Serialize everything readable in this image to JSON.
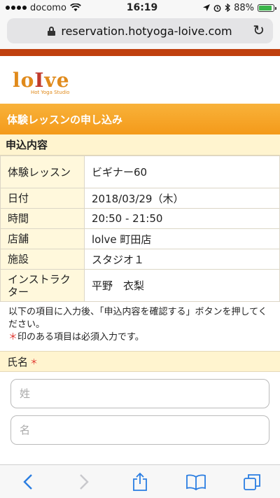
{
  "status": {
    "carrier": "docomo",
    "time": "16:19",
    "battery": "88%",
    "battery_level": 0.88
  },
  "browser": {
    "url": "reservation.hotyoga-loive.com"
  },
  "logo": {
    "text_a": "lo",
    "text_i": "I",
    "text_b": "ve",
    "sub": "Hot Yoga Studio"
  },
  "section": {
    "title": "体験レッスンの申し込み",
    "subtitle": "申込内容"
  },
  "details": [
    {
      "label": "体験レッスン",
      "value": "ビギナー60"
    },
    {
      "label": "日付",
      "value": "2018/03/29（木）"
    },
    {
      "label": "時間",
      "value": "20:50 - 21:50"
    },
    {
      "label": "店舗",
      "value": "lolve 町田店"
    },
    {
      "label": "施設",
      "value": "スタジオ１"
    },
    {
      "label": "インストラクター",
      "value": "平野　衣梨"
    }
  ],
  "notice": {
    "line1": "以下の項目に入力後、「申込内容を確認する」ボタンを押してください。",
    "star": "＊",
    "line2": "印のある項目は必須入力です。"
  },
  "form": {
    "name_label": "氏名",
    "required_mark": "＊",
    "last_name_placeholder": "姓",
    "first_name_placeholder": "名"
  },
  "colors": {
    "brand": "#c0400f",
    "header": "#f49a1a",
    "label_bg": "#fff8dc",
    "required": "#e0302a"
  }
}
